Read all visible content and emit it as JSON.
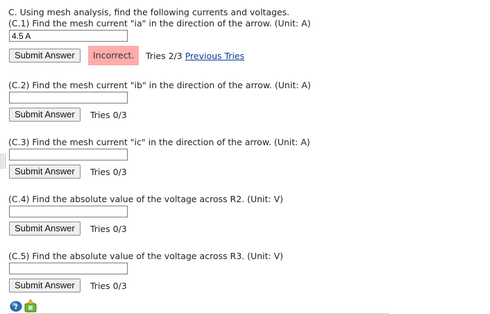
{
  "header": {
    "intro": "C. Using mesh analysis, find the following currents and voltages."
  },
  "questions": [
    {
      "prompt": "(C.1) Find the mesh current \"ia\" in the direction of the arrow. (Unit: A)",
      "value": "4.5 A",
      "submit_label": "Submit Answer",
      "status": "Incorrect.",
      "tries": "Tries 2/3",
      "previous_tries_label": "Previous Tries"
    },
    {
      "prompt": "(C.2) Find the mesh current \"ib\" in the direction of the arrow. (Unit: A)",
      "value": "",
      "submit_label": "Submit Answer",
      "tries": "Tries 0/3"
    },
    {
      "prompt": "(C.3) Find the mesh current \"ic\" in the direction of the arrow. (Unit: A)",
      "value": "",
      "submit_label": "Submit Answer",
      "tries": "Tries 0/3"
    },
    {
      "prompt": "(C.4) Find the absolute value of the voltage across R2. (Unit: V)",
      "value": "",
      "submit_label": "Submit Answer",
      "tries": "Tries 0/3"
    },
    {
      "prompt": "(C.5) Find the absolute value of the voltage across R3. (Unit: V)",
      "value": "",
      "submit_label": "Submit Answer",
      "tries": "Tries 0/3"
    }
  ],
  "footer_icons": [
    "help-icon",
    "feedback-icon"
  ],
  "colors": {
    "incorrect_bg": "#ffabab",
    "link": "#0b3d91"
  }
}
